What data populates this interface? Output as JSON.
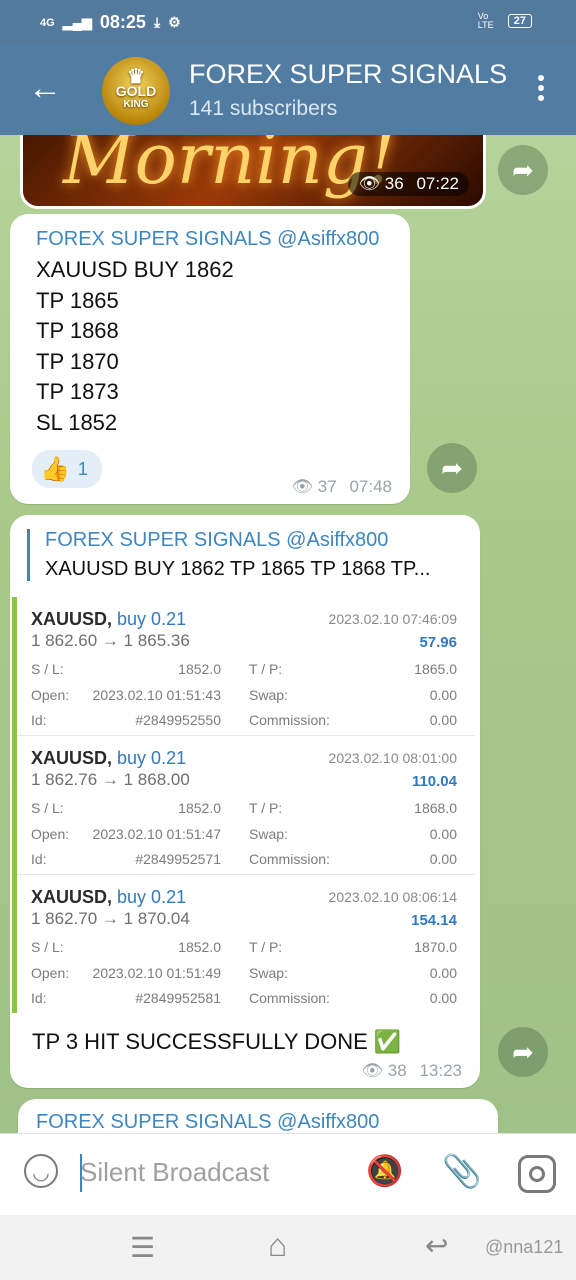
{
  "status_bar": {
    "network": "4G",
    "time": "08:25",
    "volte": "Vo LTE",
    "battery": "27"
  },
  "header": {
    "back_icon": "arrow-left-icon",
    "title": "FOREX SUPER SIGNALS",
    "subtitle": "141 subscribers",
    "avatar_text_line1": "GOLD",
    "avatar_text_line2": "KING"
  },
  "messages": {
    "image_post": {
      "image_text": "Morning!",
      "views": "36",
      "time": "07:22"
    },
    "signal": {
      "author": "FOREX SUPER SIGNALS @Asiffx800",
      "lines": [
        "XAUUSD BUY 1862",
        "TP 1865",
        "TP 1868",
        "TP 1870",
        "TP 1873",
        "SL 1852"
      ],
      "reaction_emoji": "👍",
      "reaction_count": "1",
      "views": "37",
      "time": "07:48"
    },
    "result": {
      "reply_author": "FOREX SUPER SIGNALS @Asiffx800",
      "reply_text": "XAUUSD BUY 1862 TP 1865 TP 1868 TP...",
      "trades": [
        {
          "symbol": "XAUUSD,",
          "side": "buy 0.21",
          "close_time": "2023.02.10 07:46:09",
          "prices": "1 862.60 → 1 865.36",
          "profit": "57.96",
          "sl_label": "S / L:",
          "sl": "1852.0",
          "tp_label": "T / P:",
          "tp": "1865.0",
          "open_label": "Open:",
          "open": "2023.02.10 01:51:43",
          "swap_label": "Swap:",
          "swap": "0.00",
          "id_label": "Id:",
          "id": "#2849952550",
          "comm_label": "Commission:",
          "comm": "0.00"
        },
        {
          "symbol": "XAUUSD,",
          "side": "buy 0.21",
          "close_time": "2023.02.10 08:01:00",
          "prices": "1 862.76 → 1 868.00",
          "profit": "110.04",
          "sl_label": "S / L:",
          "sl": "1852.0",
          "tp_label": "T / P:",
          "tp": "1868.0",
          "open_label": "Open:",
          "open": "2023.02.10 01:51:47",
          "swap_label": "Swap:",
          "swap": "0.00",
          "id_label": "Id:",
          "id": "#2849952571",
          "comm_label": "Commission:",
          "comm": "0.00"
        },
        {
          "symbol": "XAUUSD,",
          "side": "buy 0.21",
          "close_time": "2023.02.10 08:06:14",
          "prices": "1 862.70 → 1 870.04",
          "profit": "154.14",
          "sl_label": "S / L:",
          "sl": "1852.0",
          "tp_label": "T / P:",
          "tp": "1870.0",
          "open_label": "Open:",
          "open": "2023.02.10 01:51:49",
          "swap_label": "Swap:",
          "swap": "0.00",
          "id_label": "Id:",
          "id": "#2849952581",
          "comm_label": "Commission:",
          "comm": "0.00"
        }
      ],
      "caption": "TP 3 HIT SUCCESSFULLY DONE ✅",
      "views": "38",
      "time": "13:23"
    },
    "next_author": "FOREX SUPER SIGNALS @Asiffx800"
  },
  "input_bar": {
    "placeholder": "Silent Broadcast",
    "emoji_icon": "smile-icon",
    "mute_icon": "bell-off-icon",
    "attach_icon": "paperclip-icon",
    "camera_icon": "instagram-camera-icon"
  },
  "watermark": "@nna121",
  "colors": {
    "header": "#527da3",
    "accent": "#3d86bf",
    "profit": "#3279c0",
    "trade_bar": "#8cc63f"
  }
}
